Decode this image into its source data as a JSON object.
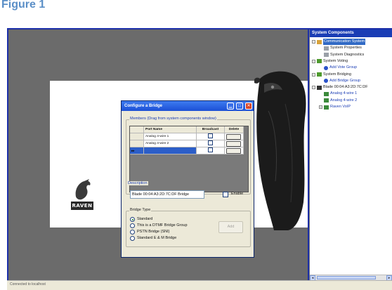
{
  "figure_label": "Figure 1",
  "status_bar": {
    "text": "Connected to localhost"
  },
  "brand": {
    "logo_text": "RAVEN"
  },
  "components_panel": {
    "title": "System Components",
    "tree": [
      {
        "label": "Communication System",
        "selected": true,
        "link": false,
        "toggle": "−"
      },
      {
        "label": "System Properties",
        "selected": false,
        "link": false,
        "toggle": ""
      },
      {
        "label": "System Diagnostics",
        "selected": false,
        "link": false,
        "toggle": ""
      },
      {
        "label": "System Voting",
        "selected": false,
        "link": false,
        "toggle": "−"
      },
      {
        "label": "Add Vote Group",
        "selected": false,
        "link": true,
        "toggle": ""
      },
      {
        "label": "System Bridging",
        "selected": false,
        "link": false,
        "toggle": "−"
      },
      {
        "label": "Add Bridge Group",
        "selected": false,
        "link": true,
        "toggle": ""
      },
      {
        "label": "Blade 00:04:A3:2D:7C:DF",
        "selected": false,
        "link": false,
        "toggle": "−"
      },
      {
        "label": "Analog 4-wire 1",
        "selected": false,
        "link": true,
        "toggle": ""
      },
      {
        "label": "Analog 4-wire 2",
        "selected": false,
        "link": true,
        "toggle": ""
      },
      {
        "label": "Raven VoIP",
        "selected": false,
        "link": true,
        "toggle": "+"
      }
    ]
  },
  "dialog": {
    "title": "Configure a Bridge",
    "members_label": "Members (Drag from system components window)",
    "columns": {
      "port_name": "Port Name",
      "broadcast": "Broadcast",
      "delete": "Delete"
    },
    "rows": [
      {
        "marker": "",
        "port_name": "Analog 4-wire 1"
      },
      {
        "marker": "",
        "port_name": "Analog 4-wire 2"
      },
      {
        "marker": "▸▸",
        "port_name": ""
      }
    ],
    "description_label": "Description",
    "description_value": "Blade 00:04:A3:2D:7C:DF Bridge",
    "enable_label": "Enable",
    "bridge_type_label": "Bridge Type",
    "bridge_types": [
      {
        "label": "Standard",
        "selected": true
      },
      {
        "label": "This is a DTMF Bridge Group",
        "selected": false
      },
      {
        "label": "PSTN Bridge (SNI)",
        "selected": false
      },
      {
        "label": "Standard E & M Bridge",
        "selected": false
      }
    ],
    "add_label": "Add"
  }
}
